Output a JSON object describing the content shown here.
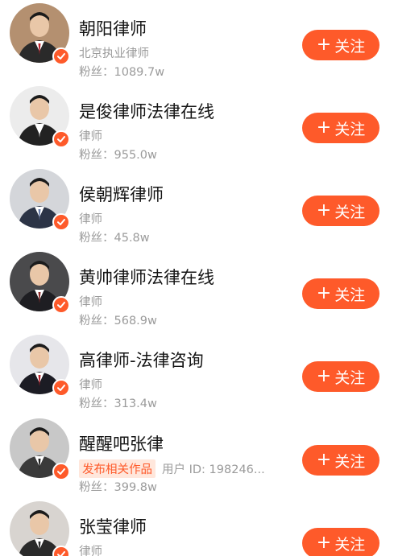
{
  "accent": "#fe5a2a",
  "items": [
    {
      "name": "朝阳律师",
      "sub": "北京执业律师",
      "tag": "",
      "fans": "粉丝：1089.7w",
      "follow": "关注",
      "avatar_bg": "#b49070",
      "suit": "#2a2a2a",
      "tie": "#b8202a"
    },
    {
      "name": "是俊律师法律在线",
      "sub": "律师",
      "tag": "",
      "fans": "粉丝：955.0w",
      "follow": "关注",
      "avatar_bg": "#ececec",
      "suit": "#222222",
      "tie": "#ffffff"
    },
    {
      "name": "侯朝辉律师",
      "sub": "律师",
      "tag": "",
      "fans": "粉丝：45.8w",
      "follow": "关注",
      "avatar_bg": "#d4d6da",
      "suit": "#2c3446",
      "tie": "#6b7ea8"
    },
    {
      "name": "黄帅律师法律在线",
      "sub": "律师",
      "tag": "",
      "fans": "粉丝：568.9w",
      "follow": "关注",
      "avatar_bg": "#4a4a4c",
      "suit": "#1e1e22",
      "tie": "#8a2a2a"
    },
    {
      "name": "高律师-法律咨询",
      "sub": "律师",
      "tag": "",
      "fans": "粉丝：313.4w",
      "follow": "关注",
      "avatar_bg": "#e6e6ea",
      "suit": "#1c1c24",
      "tie": "#b8202a"
    },
    {
      "name": "醒醒吧张律",
      "sub": "用户 ID: 198246...",
      "tag": "发布相关作品",
      "fans": "粉丝：399.8w",
      "follow": "关注",
      "avatar_bg": "#c8c8c8",
      "suit": "#3a3a3a",
      "tie": "#222222"
    },
    {
      "name": "张莹律师",
      "sub": "律师",
      "tag": "",
      "fans": "",
      "follow": "关注",
      "avatar_bg": "#d8d4d0",
      "suit": "#2a2a2a",
      "tie": "#2a2a2a"
    }
  ]
}
